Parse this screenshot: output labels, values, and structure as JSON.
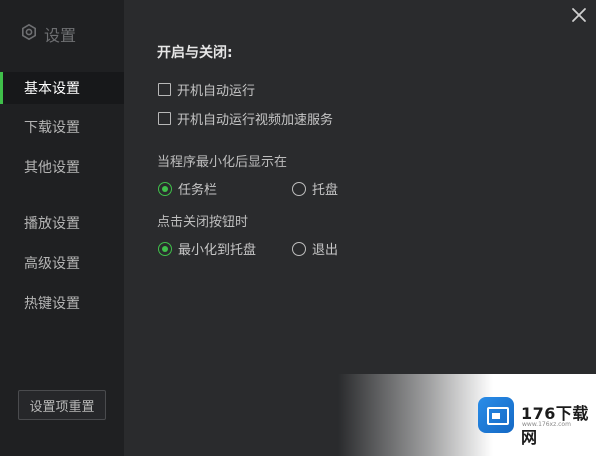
{
  "window": {
    "title": "设置",
    "close_icon": "close-icon"
  },
  "sidebar": {
    "items": [
      {
        "label": "基本设置",
        "active": true
      },
      {
        "label": "下载设置",
        "active": false
      },
      {
        "label": "其他设置",
        "active": false
      },
      {
        "label": "播放设置",
        "active": false
      },
      {
        "label": "高级设置",
        "active": false
      },
      {
        "label": "热键设置",
        "active": false
      }
    ],
    "reset_label": "设置项重置"
  },
  "main": {
    "section_title": "开启与关闭:",
    "checks": [
      {
        "label": "开机自动运行",
        "checked": false
      },
      {
        "label": "开机自动运行视频加速服务",
        "checked": false
      }
    ],
    "minimize_group": {
      "label": "当程序最小化后显示在",
      "options": [
        {
          "label": "任务栏",
          "selected": true
        },
        {
          "label": "托盘",
          "selected": false
        }
      ]
    },
    "close_group": {
      "label": "点击关闭按钮时",
      "options": [
        {
          "label": "最小化到托盘",
          "selected": true
        },
        {
          "label": "退出",
          "selected": false
        }
      ]
    }
  },
  "watermark": {
    "text": "176下载网",
    "sub": "www.176xz.com"
  },
  "colors": {
    "accent": "#3fbf4a",
    "sidebar_bg": "#1f2022",
    "main_bg": "#2a2b2d"
  }
}
